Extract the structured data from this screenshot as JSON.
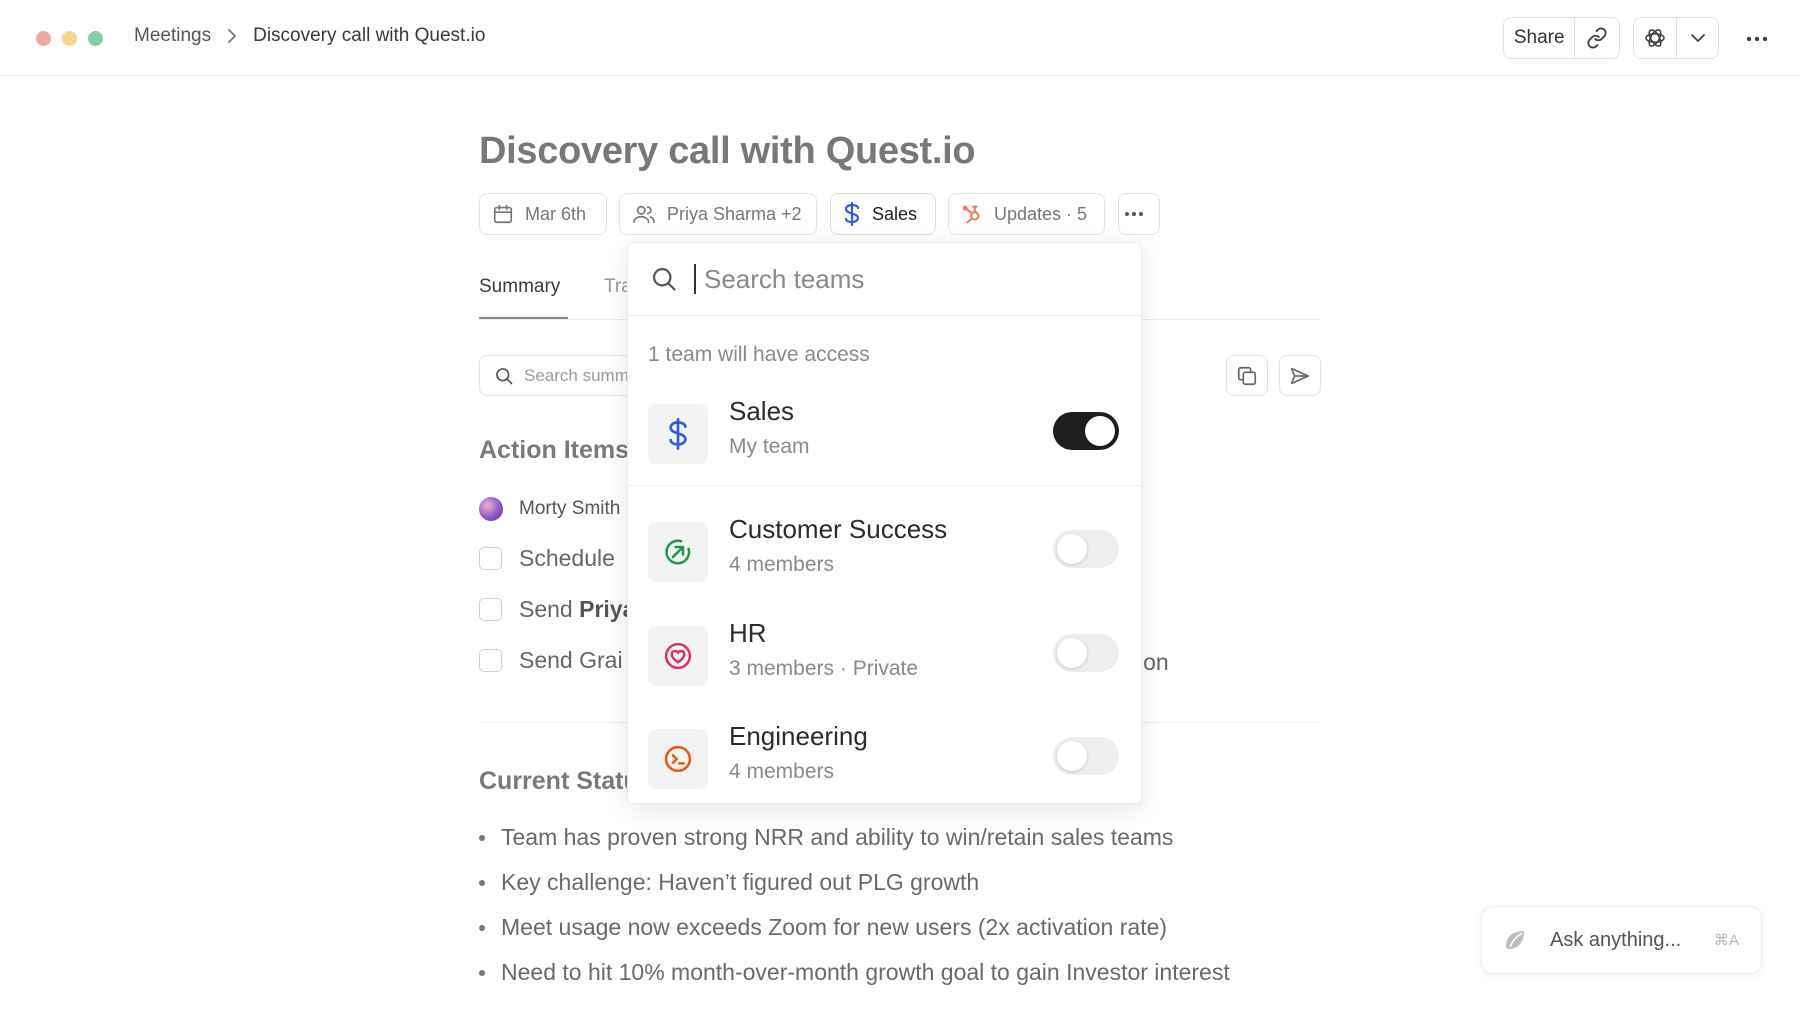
{
  "window": {
    "breadcrumb": {
      "parent": "Meetings",
      "current": "Discovery call with Quest.io"
    },
    "share_label": "Share"
  },
  "page": {
    "title": "Discovery call with Quest.io",
    "chips": {
      "date": "Mar 6th",
      "people": "Priya Sharma +2",
      "team": "Sales",
      "updates": "Updates · 5"
    },
    "tabs": {
      "summary": "Summary",
      "second": "Tra"
    },
    "search_placeholder": "Search summary",
    "action_items": {
      "heading": "Action Items",
      "assignee": "Morty Smith",
      "tasks": [
        {
          "text": "Schedule"
        },
        {
          "prefix": "Send ",
          "bold": "Priya"
        },
        {
          "text": "Send Grai",
          "tail": "ion"
        }
      ]
    },
    "current_status": {
      "heading": "Current Status",
      "bullets": [
        "Team has proven strong NRR and ability to win/retain sales teams",
        "Key challenge: Haven’t figured out PLG growth",
        "Meet usage now exceeds Zoom for new users (2x activation rate)",
        "Need to hit 10% month-over-month growth goal to gain Investor interest"
      ]
    }
  },
  "team_picker": {
    "search_placeholder": "Search teams",
    "access_label": "1 team will have access",
    "teams": [
      {
        "name": "Sales",
        "subtitle": "My team",
        "enabled": true,
        "icon": "dollar-icon",
        "color": "#2f5fd6"
      },
      {
        "name": "Customer Success",
        "subtitle": "4 members",
        "enabled": false,
        "icon": "arrow-up-right-circle-icon",
        "color": "#1f9a4b"
      },
      {
        "name": "HR",
        "subtitle": "3 members · Private",
        "enabled": false,
        "icon": "heart-circle-icon",
        "color": "#d6336c"
      },
      {
        "name": "Engineering",
        "subtitle": "4 members",
        "enabled": false,
        "icon": "terminal-circle-icon",
        "color": "#e8590c"
      }
    ]
  },
  "assistant": {
    "placeholder": "Ask anything...",
    "shortcut": "⌘A"
  }
}
